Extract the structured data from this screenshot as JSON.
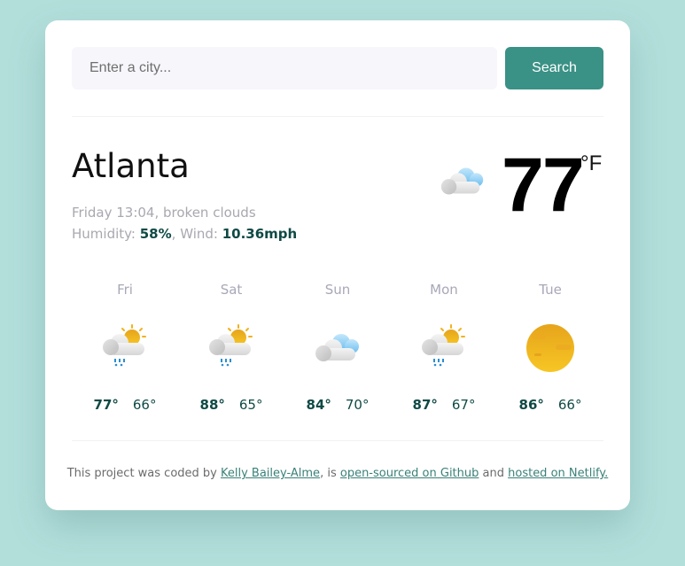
{
  "search": {
    "placeholder": "Enter a city...",
    "value": "",
    "button_label": "Search"
  },
  "current": {
    "city": "Atlanta",
    "day_time": "Friday 13:04",
    "description": "broken clouds",
    "humidity_label": "Humidity: ",
    "humidity": "58%",
    "wind_label": "Wind: ",
    "wind": "10.36mph",
    "temperature": "77",
    "unit": "°F",
    "icon": "broken-clouds-icon"
  },
  "forecast": [
    {
      "day": "Fri",
      "high": "77°",
      "low": "66°",
      "icon": "sun-cloud-rain-icon"
    },
    {
      "day": "Sat",
      "high": "88°",
      "low": "65°",
      "icon": "sun-cloud-rain-icon"
    },
    {
      "day": "Sun",
      "high": "84°",
      "low": "70°",
      "icon": "broken-clouds-icon"
    },
    {
      "day": "Mon",
      "high": "87°",
      "low": "67°",
      "icon": "sun-cloud-rain-icon"
    },
    {
      "day": "Tue",
      "high": "86°",
      "low": "66°",
      "icon": "sun-haze-icon"
    }
  ],
  "footer": {
    "prefix": "This project was coded by ",
    "author": "Kelly Bailey-Alme",
    "middle1": ", is ",
    "github_link": "open-sourced on Github",
    "middle2": " and ",
    "netlify_link": "hosted on Netlify."
  },
  "colors": {
    "accent": "#3a9185",
    "background": "#b3dfdb",
    "value_text": "#0f4a45"
  }
}
